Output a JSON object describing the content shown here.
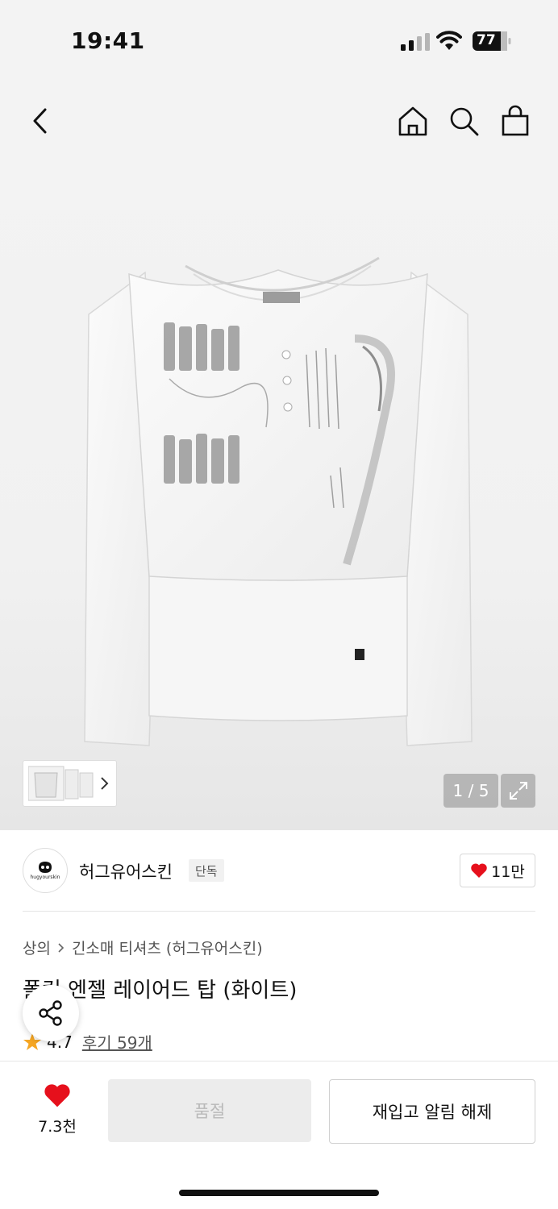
{
  "status_bar": {
    "time": "19:41",
    "battery": "77"
  },
  "nav": {
    "back": "back-icon",
    "home": "home-icon",
    "search": "search-icon",
    "cart": "shopping-bag-icon"
  },
  "gallery": {
    "counter": "1 / 5"
  },
  "brand": {
    "name": "허그유어스킨",
    "badge": "단독",
    "likes": "11만",
    "logo_text": "hugyourskin"
  },
  "breadcrumb": {
    "category": "상의",
    "subcategory": "긴소매 티셔츠 (허그유어스킨)"
  },
  "product": {
    "title": "폴컨 엔젤 레이어드 탑 (화이트)",
    "rating": "4.7",
    "reviews": "후기 59개"
  },
  "bottom": {
    "wish_count": "7.3천",
    "soldout_label": "품절",
    "restock_label": "재입고 알림 해제"
  },
  "colors": {
    "accent_red": "#e6101c",
    "star": "#f5a623"
  }
}
